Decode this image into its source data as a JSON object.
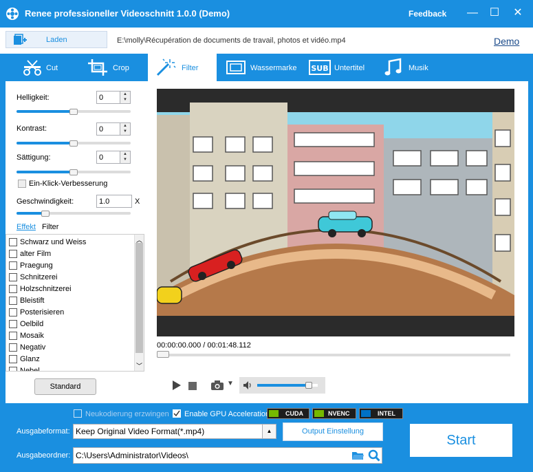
{
  "window": {
    "title": "Renee professioneller Videoschnitt 1.0.0 (Demo)",
    "feedback": "Feedback",
    "minimize": "—",
    "maximize": "☐",
    "close": "✕"
  },
  "loadbar": {
    "load_label": "Laden",
    "file_path": "E:\\molly\\Récupération de documents de travail, photos et vidéo.mp4",
    "demo_link": "Demo"
  },
  "tabs": [
    {
      "label": "Cut",
      "icon": "scissors-icon",
      "active": false
    },
    {
      "label": "Crop",
      "icon": "crop-icon",
      "active": false
    },
    {
      "label": "Filter",
      "icon": "magic-wand-icon",
      "active": true
    },
    {
      "label": "Wassermarke",
      "icon": "watermark-icon",
      "active": false
    },
    {
      "label": "Untertitel",
      "icon": "subtitle-icon",
      "active": false
    },
    {
      "label": "Musik",
      "icon": "music-note-icon",
      "active": false
    }
  ],
  "adjust": {
    "brightness_label": "Helligkeit:",
    "brightness_value": "0",
    "brightness_level": 0.5,
    "contrast_label": "Kontrast:",
    "contrast_value": "0",
    "contrast_level": 0.5,
    "saturation_label": "Sättigung:",
    "saturation_value": "0",
    "saturation_level": 0.5,
    "one_click_label": "Ein-Klick-Verbesserung",
    "speed_label": "Geschwindigkeit:",
    "speed_value": "1.0",
    "speed_unit": "X",
    "speed_level": 0.25
  },
  "filter_section": {
    "effekt_link": "Effekt",
    "filter_label": "Filter",
    "items": [
      "Schwarz und Weiss",
      "alter Film",
      "Praegung",
      "Schnitzerei",
      "Holzschnitzerei",
      "Bleistift",
      "Posterisieren",
      "Oelbild",
      "Mosaik",
      "Negativ",
      "Glanz",
      "Nebel"
    ],
    "standard_button": "Standard"
  },
  "player": {
    "timecode": "00:00:00.000 / 00:01:48.112",
    "seek_position": 0.0,
    "volume_level": 0.85
  },
  "bottom": {
    "force_reencode_label": "Neukodierung erzwingen",
    "gpu_label": "Enable GPU Acceleration",
    "gpu_badges": [
      "CUDA",
      "NVENC",
      "INTEL"
    ],
    "format_label": "Ausgabeformat:",
    "format_value": "Keep Original Video Format(*.mp4)",
    "output_settings": "Output Einstellung",
    "folder_label": "Ausgabeordner:",
    "folder_value": "C:\\Users\\Administrator\\Videos\\",
    "start_button": "Start"
  },
  "colors": {
    "accent": "#1a8fe0",
    "panel": "#ffffff"
  }
}
